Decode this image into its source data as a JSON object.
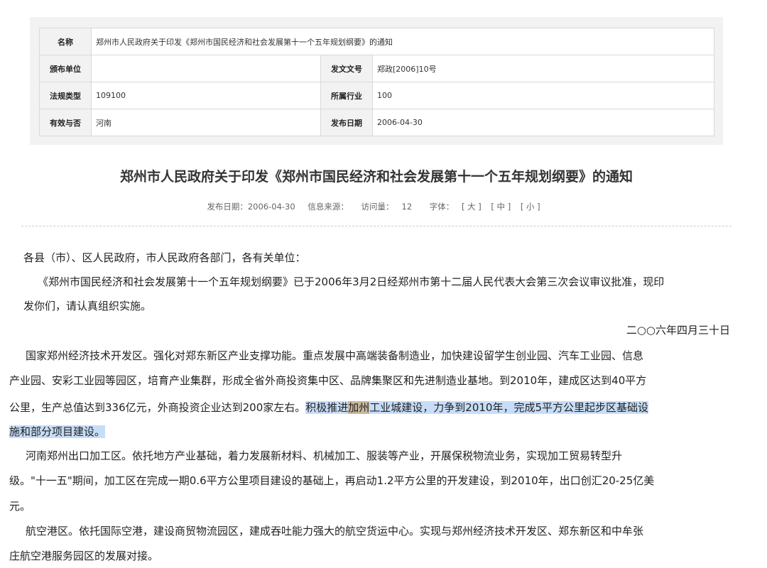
{
  "info": {
    "name_label": "名称",
    "name_value": "郑州市人民政府关于印发《郑州市国民经济和社会发展第十一个五年规划纲要》的通知",
    "issuer_label": "颁布单位",
    "issuer_value": "",
    "doc_no_label": "发文文号",
    "doc_no_value": "郑政[2006]10号",
    "type_label": "法规类型",
    "type_value": "109100",
    "industry_label": "所属行业",
    "industry_value": "100",
    "validity_label": "有效与否",
    "validity_value": "河南",
    "date_label": "发布日期",
    "date_value": "2006-04-30"
  },
  "title": "郑州市人民政府关于印发《郑州市国民经济和社会发展第十一个五年规划纲要》的通知",
  "meta": {
    "publish_date": "发布日期：2006-04-30",
    "source": "信息来源：",
    "visits_label": "访问量：",
    "visits_value": "12",
    "font_label": "字体：",
    "font_large": "[ 大 ]",
    "font_medium": "[ 中 ]",
    "font_small": "[ 小 ]"
  },
  "body": {
    "salutation": "各县（市）、区人民政府，市人民政府各部门，各有关单位：",
    "p1_line1": "《郑州市国民经济和社会发展第十一个五年规划纲要》已于2006年3月2日经郑州市第十二届人民代表大会第三次会议审议批准，现印",
    "p1_line2": "发你们，请认真组织实施。",
    "date_sign": "二○○六年四月三十日",
    "p2_line1": "国家郑州经济技术开发区。强化对郑东新区产业支撑功能。重点发展中高端装备制造业，加快建设留学生创业园、汽车工业园、信息",
    "p2_line2": "产业园、安彩工业园等园区，培育产业集群，形成全省外商投资集中区、品牌集聚区和先进制造业基地。到2010年，建成区达到40平方",
    "p2_line3_a": "公里，生产总值达到336亿元，外商投资企业达到200家左右。",
    "p2_line3_b": "积极推进",
    "p2_line3_c": "加州",
    "p2_line3_d": "工业城建设，力争到2010年，完成5平方公里起步区基础设",
    "p2_line4": "施和部分项目建设。",
    "p3_line1": "河南郑州出口加工区。依托地方产业基础，着力发展新材料、机械加工、服装等产业，开展保税物流业务，实现加工贸易转型升",
    "p3_line2": "级。\"十一五\"期间，加工区在完成一期0.6平方公里项目建设的基础上，再启动1.2平方公里的开发建设，到2010年，出口创汇20-25亿美",
    "p3_line3": "元。",
    "p4_line1": "航空港区。依托国际空港，建设商贸物流园区，建成吞吐能力强大的航空货运中心。实现与郑州经济技术开发区、郑东新区和中牟张",
    "p4_line2": "庄航空港服务园区的发展对接。"
  }
}
